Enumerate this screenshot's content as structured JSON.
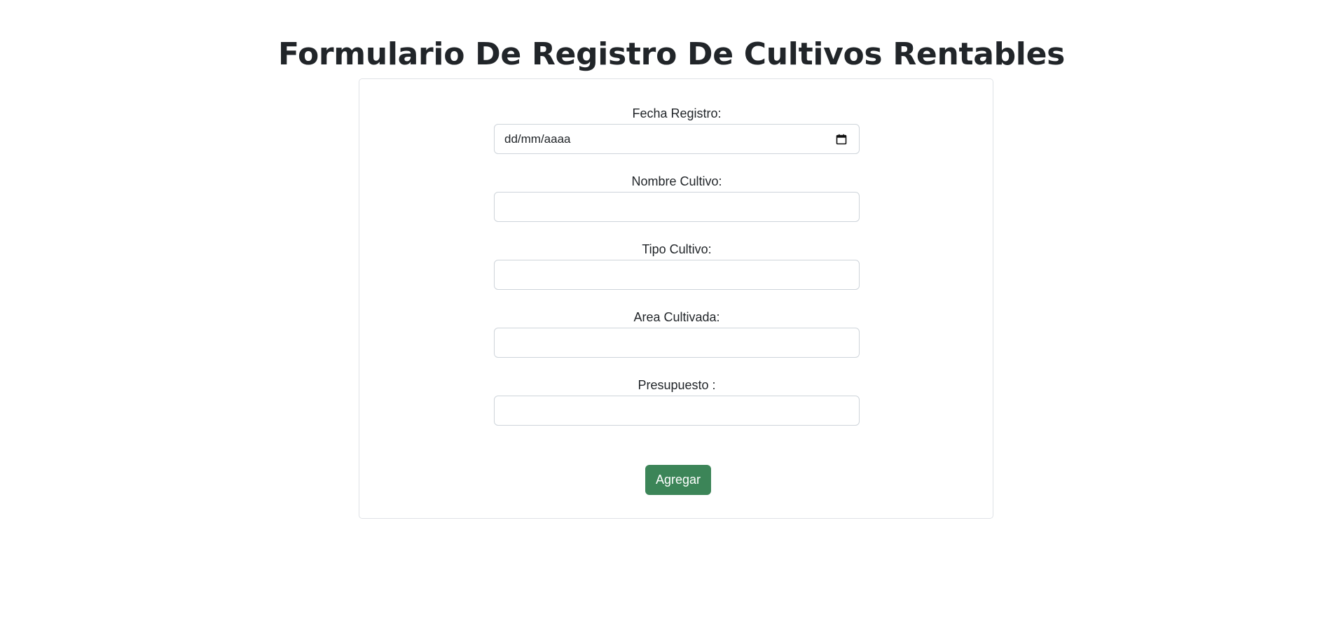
{
  "page": {
    "title": "Formulario De Registro De Cultivos Rentables"
  },
  "form": {
    "fields": [
      {
        "label": "Fecha Registro:",
        "type": "date",
        "placeholder": "dd/mm/aaaa",
        "value": "",
        "icon": "calendar-icon"
      },
      {
        "label": "Nombre Cultivo:",
        "type": "text",
        "value": ""
      },
      {
        "label": "Tipo Cultivo:",
        "type": "text",
        "value": ""
      },
      {
        "label": "Area Cultivada:",
        "type": "text",
        "value": ""
      },
      {
        "label": "Presupuesto :",
        "type": "text",
        "value": ""
      }
    ],
    "submit_label": "Agregar"
  },
  "colors": {
    "button_bg": "#3c8558",
    "button_text": "#ffffff",
    "text": "#212529",
    "border": "#ced4da"
  }
}
